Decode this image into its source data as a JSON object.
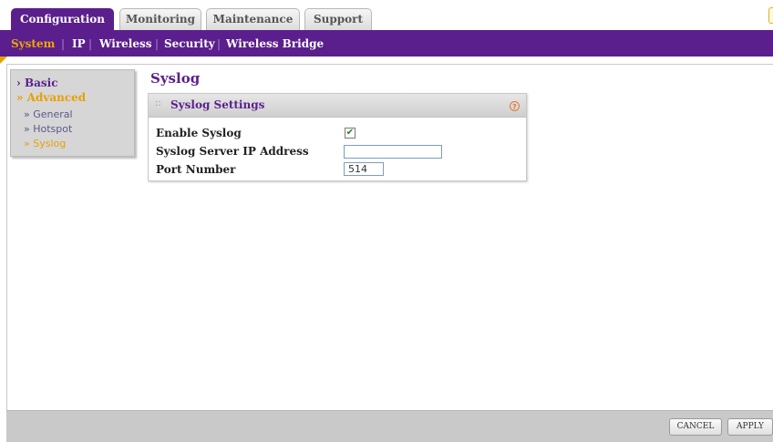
{
  "tabs": [
    {
      "label": "Configuration",
      "active": true
    },
    {
      "label": "Monitoring",
      "active": false
    },
    {
      "label": "Maintenance",
      "active": false
    },
    {
      "label": "Support",
      "active": false
    }
  ],
  "subnav": {
    "items": [
      {
        "label": "System",
        "active": true
      },
      {
        "label": "IP",
        "active": false
      },
      {
        "label": "Wireless",
        "active": false
      },
      {
        "label": "Security",
        "active": false
      },
      {
        "label": "Wireless Bridge",
        "active": false
      }
    ],
    "separator": "|"
  },
  "left_menu": {
    "basic": "› Basic",
    "advanced": "» Advanced",
    "sub_items": [
      {
        "label": "» General",
        "active": false
      },
      {
        "label": "» Hotspot",
        "active": false
      },
      {
        "label": "» Syslog",
        "active": true
      }
    ]
  },
  "page": {
    "title": "Syslog",
    "panel_title": "Syslog Settings",
    "help_icon": "?",
    "grip": "::",
    "rows": {
      "enable_label": "Enable Syslog",
      "enable_checked": true,
      "enable_mark": "✔",
      "server_label": "Syslog Server IP Address",
      "server_value": "",
      "port_label": "Port Number",
      "port_value": "514"
    }
  },
  "buttons": {
    "cancel": "CANCEL",
    "apply": "APPLY"
  },
  "colors": {
    "brand_purple": "#5a1f8c",
    "accent_orange": "#e8a000"
  }
}
